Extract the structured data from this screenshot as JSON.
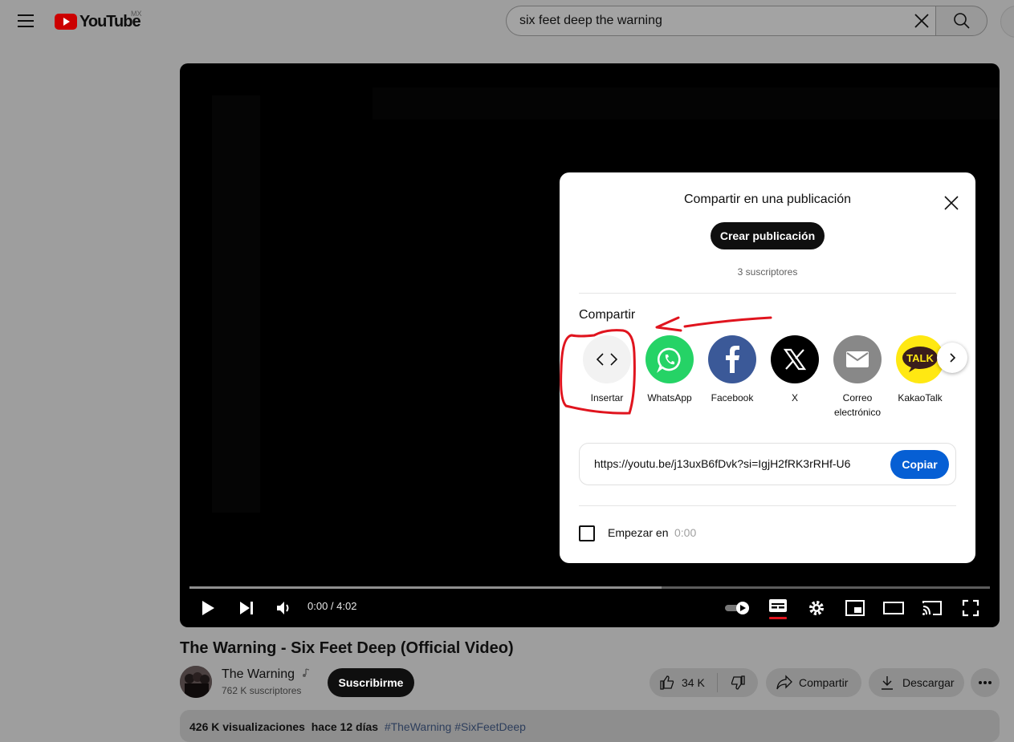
{
  "header": {
    "logo_text": "YouTube",
    "region": "MX",
    "search": {
      "value": "six feet deep the warning"
    }
  },
  "player": {
    "time": "0:00 / 4:02",
    "progress": 0.59
  },
  "share_dialog": {
    "title": "Compartir en una publicación",
    "create_post_label": "Crear publicación",
    "subscribers": "3 suscriptores",
    "share_heading": "Compartir",
    "targets": [
      {
        "label": "Insertar",
        "icon": "embed-icon",
        "color": "#f2f2f2"
      },
      {
        "label": "WhatsApp",
        "icon": "whatsapp-icon",
        "color": "#25d366"
      },
      {
        "label": "Facebook",
        "icon": "facebook-icon",
        "color": "#3b5998"
      },
      {
        "label": "X",
        "icon": "x-icon",
        "color": "#000000"
      },
      {
        "label": "Correo electrónico",
        "icon": "mail-icon",
        "color": "#888888"
      },
      {
        "label": "KakaoTalk",
        "icon": "kakaotalk-icon",
        "color": "#ffe812"
      }
    ],
    "kakao_badge": "TALK",
    "link": "https://youtu.be/j13uxB6fDvk?si=IgjH2fRK3rRHf-U6",
    "copy_label": "Copiar",
    "start_at_label": "Empezar en",
    "start_at_time": "0:00",
    "start_at_checked": false
  },
  "video": {
    "title": "The Warning - Six Feet Deep (Official Video)",
    "channel": "The Warning",
    "channel_subs": "762 K suscriptores",
    "subscribe_label": "Suscribirme",
    "likes": "34 K",
    "share_label": "Compartir",
    "download_label": "Descargar",
    "views": "426 K visualizaciones",
    "age": "hace 12 días",
    "hashtags": "#TheWarning #SixFeetDeep"
  },
  "colors": {
    "accent_blue": "#065fd4",
    "annotation_red": "#e0141e"
  }
}
